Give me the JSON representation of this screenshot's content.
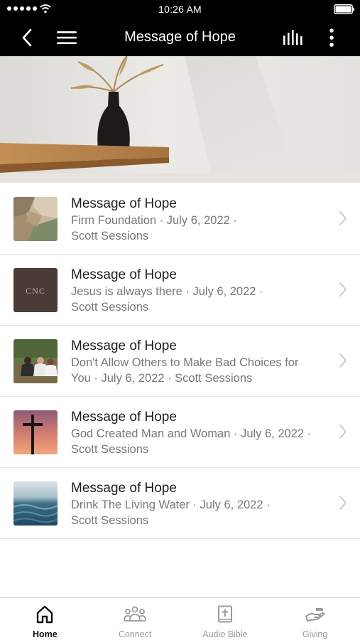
{
  "status_bar": {
    "time": "10:26 AM"
  },
  "nav": {
    "title": "Message of Hope",
    "back_icon": "chevron-left-icon",
    "menu_icon": "hamburger-icon",
    "stats_icon": "audio-bars-icon",
    "more_icon": "vertical-dots-icon"
  },
  "items": [
    {
      "title": "Message of Hope",
      "line1": "Firm Foundation · July 6, 2022 ·",
      "line2": "Scott Sessions",
      "thumb": "rocks"
    },
    {
      "title": "Message of Hope",
      "line1": "Jesus is always there · July 6, 2022 ·",
      "line2": "Scott Sessions",
      "thumb": "logo"
    },
    {
      "title": "Message of Hope",
      "line1": "Don't Allow Others to Make Bad Choices for",
      "line2": "You · July 6, 2022 · Scott Sessions",
      "thumb": "people"
    },
    {
      "title": "Message of Hope",
      "line1": "God Created Man and Woman · July 6, 2022 ·",
      "line2": "Scott Sessions",
      "thumb": "cross"
    },
    {
      "title": "Message of Hope",
      "line1": "Drink The Living Water · July 6, 2022 ·",
      "line2": "Scott Sessions",
      "thumb": "water"
    }
  ],
  "thumb_logo_text": "CNC",
  "tabs": [
    {
      "label": "Home",
      "icon": "home-icon",
      "active": true
    },
    {
      "label": "Connect",
      "icon": "people-icon",
      "active": false
    },
    {
      "label": "Audio Bible",
      "icon": "bible-icon",
      "active": false
    },
    {
      "label": "Giving",
      "icon": "giving-hand-icon",
      "active": false
    }
  ],
  "colors": {
    "bar_bg": "#000000",
    "title_text": "#1e1e1e",
    "subtitle_text": "#777777",
    "tab_inactive": "#9a9a9a",
    "tab_active": "#111111"
  }
}
